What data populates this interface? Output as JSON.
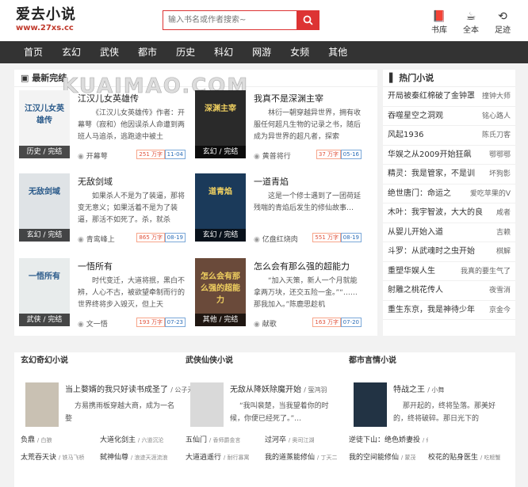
{
  "logo": {
    "title": "爱去小说",
    "url": "www.27xs.cc"
  },
  "search": {
    "placeholder": "输入书名或作者搜索~"
  },
  "header_links": [
    {
      "label": "书库",
      "glyph": "📕"
    },
    {
      "label": "全本",
      "glyph": "☕"
    },
    {
      "label": "足迹",
      "glyph": "⟲"
    }
  ],
  "nav": [
    "首页",
    "玄幻",
    "武侠",
    "都市",
    "历史",
    "科幻",
    "网游",
    "女频",
    "其他"
  ],
  "main": {
    "heading": "最新完结",
    "watermark": "KUAIMAO.COM",
    "books": [
      {
        "title": "江汉儿女英雄传",
        "desc": "《江汉儿女英雄传》作者：开幕萼（寂和）他因误杀人命遭到两班人马追杀，逃跑途中被土",
        "author": "开幕萼",
        "words": "251 万字",
        "date": "11-04",
        "tag": "历史 / 完结",
        "cover_title": "江汉儿女英雄传",
        "cover_color": "#f3f3f3"
      },
      {
        "title": "我真不是深渊主宰",
        "desc": "林衍一朝穿越异世界，拥有收服任何超凡生物的记录之书，随后成为异世界的超凡者，探索",
        "author": "黄普将行",
        "words": "37 万字",
        "date": "05-16",
        "tag": "玄幻 / 完结",
        "cover_title": "深渊主宰",
        "cover_color": "#2a2a2a"
      },
      {
        "title": "无敌剑域",
        "desc": "如果杀人不是为了装逼，那将变无意义；如果活着不是为了装逼，那活不如死了。杀，就杀",
        "author": "青鸾峰上",
        "words": "865 万字",
        "date": "08-19",
        "tag": "玄幻 / 完结",
        "cover_title": "无敌剑域",
        "cover_color": "#dfe3e6"
      },
      {
        "title": "一道青焰",
        "desc": "这是一个修士遇到了一团荷延残喘的青焰后发生的修仙故事…",
        "author": "亿盘红烧肉",
        "words": "551 万字",
        "date": "08-19",
        "tag": "玄幻 / 完结",
        "cover_title": "道青焰",
        "cover_color": "#1b3a5a"
      },
      {
        "title": "一悟所有",
        "desc": "时代变迁，大道将抿，黑白不辨，人心不古，被欲望牵制而行的世界终将步入毁灭，但上天",
        "author": "文一悟",
        "words": "193 万字",
        "date": "07-23",
        "tag": "武侠 / 完结",
        "cover_title": "一悟所有",
        "cover_color": "#e8ecec"
      },
      {
        "title": "怎么会有那么强的超能力",
        "desc": "“加入天策，新人一个月就能拿两万块，还交五险一金。”“……那我加入。”陈鹿思趁机",
        "author": "献歌",
        "words": "163 万字",
        "date": "07-20",
        "tag": "其他 / 完结",
        "cover_title": "怎么会有那么强的超能力",
        "cover_color": "#6a4a3a"
      }
    ]
  },
  "side": {
    "heading": "热门小说",
    "items": [
      {
        "title": "开局被秦红棉破了金钟罩",
        "author": "撞钟大师"
      },
      {
        "title": "吞噬星空之洞观",
        "author": "铭心路人"
      },
      {
        "title": "风起1936",
        "author": "陈氏刀客"
      },
      {
        "title": "华娱之从2009开始狂飙",
        "author": "鄂鄂鄂"
      },
      {
        "title": "精灵：我是管家，不是训",
        "author": "坏狗影"
      },
      {
        "title": "绝世唐门：命运之",
        "author": "爱吃苹果的V"
      },
      {
        "title": "木叶：我宇智波，大大的良",
        "author": "咸者"
      },
      {
        "title": "从婴儿开始入道",
        "author": "吉赖"
      },
      {
        "title": "斗罗：从武魂时之虫开始",
        "author": "棋解"
      },
      {
        "title": "重塑华娱人生",
        "author": "我真的要生气了"
      },
      {
        "title": "射雕之桃花传人",
        "author": "夜雪消"
      },
      {
        "title": "重生东京，我是神待少年",
        "author": "京金今"
      }
    ]
  },
  "bottom": [
    {
      "heading": "玄幻奇幻小说",
      "title": "当上婺婿的我只好读书成圣了",
      "author": "/ 公子无哨",
      "desc": "方易携雨板穿越大商，成为一名婺",
      "cover_color": "#c9c1b3",
      "rows": [
        [
          "负鼎",
          "/ 白狼",
          "大道化剑主",
          "/ 六道沉沦"
        ],
        [
          "太荒吞天诀",
          "/ 铁马飞桥",
          "弑神仙尊",
          "/ 浪迹天涯流浪"
        ]
      ]
    },
    {
      "heading": "武侠仙侠小说",
      "title": "无敌从降妖除魔开始",
      "author": "/ 萤鸿羽",
      "desc": "“我叫裴楚，当我望着你的时候，你便已经死了。”…",
      "cover_color": "#d9d9d9",
      "rows": [
        [
          "五仙门",
          "/ 香师爵金言",
          "过河卒",
          "/ 奥司江湖"
        ],
        [
          "大道逍遥行",
          "/ 耐行寡寓",
          "我的道蒸能修仙",
          "/ 丁天二"
        ]
      ]
    },
    {
      "heading": "都市言情小说",
      "title": "特战之王",
      "author": "/ 小舞",
      "desc": "那开起的，终将坠落。那美好的，终将破碎。那日光下的",
      "cover_color": "#223344",
      "rows": [
        [
          "逆徒下山：绝色娇妻投",
          "/ 修仙十年，下山即无",
          ""
        ],
        [
          "我的空间能修仙",
          "/ 蒙茂",
          "校花的贴身医生",
          "/ 吃螃蟹"
        ]
      ]
    }
  ]
}
